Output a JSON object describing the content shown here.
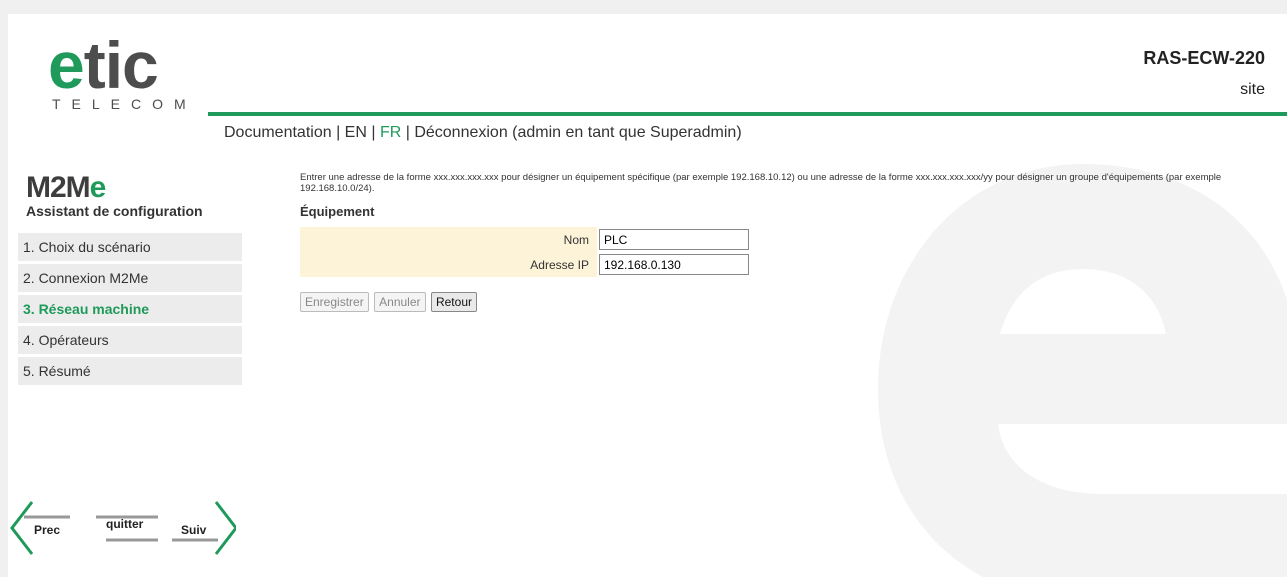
{
  "header": {
    "logo_word_part1": "e",
    "logo_word_part2": "tic",
    "logo_sub": "TELECOM",
    "device_name": "RAS-ECW-220",
    "device_site": "site"
  },
  "topnav": {
    "documentation": "Documentation",
    "sep1": " | ",
    "en": "EN",
    "sep2": " | ",
    "fr": "FR",
    "sep3": " | ",
    "logout": "Déconnexion (admin en tant que Superadmin)"
  },
  "sidebar": {
    "title_part1": "M2M",
    "title_part2": "e",
    "subtitle": "Assistant de configuration",
    "items": [
      {
        "label": "1. Choix du scénario"
      },
      {
        "label": "2. Connexion M2Me"
      },
      {
        "label": "3. Réseau machine"
      },
      {
        "label": "4. Opérateurs"
      },
      {
        "label": "5. Résumé"
      }
    ],
    "nav": {
      "prev": "Prec",
      "quit": "quitter",
      "next": "Suiv"
    }
  },
  "main": {
    "help_text": "Entrer une adresse de la forme xxx.xxx.xxx.xxx pour désigner un équipement spécifique (par exemple 192.168.10.12) ou une adresse de la forme xxx.xxx.xxx.xxx/yy pour désigner un groupe d'équipements (par exemple 192.168.10.0/24).",
    "section_title": "Équipement",
    "fields": {
      "name_label": "Nom",
      "name_value": "PLC",
      "ip_label": "Adresse IP",
      "ip_value": "192.168.0.130"
    },
    "buttons": {
      "save": "Enregistrer",
      "cancel": "Annuler",
      "back": "Retour"
    }
  },
  "colors": {
    "brand_green": "#1f9a5b",
    "form_label_bg": "#fdf3d9"
  }
}
